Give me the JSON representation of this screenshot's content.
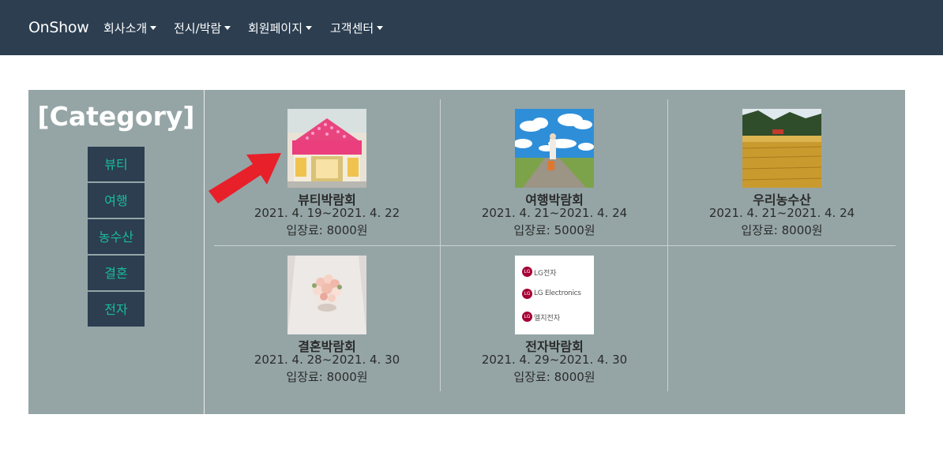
{
  "nav": {
    "brand": "OnShow",
    "items": [
      {
        "label": "회사소개"
      },
      {
        "label": "전시/박람"
      },
      {
        "label": "회원페이지"
      },
      {
        "label": "고객센터"
      }
    ]
  },
  "sidebar": {
    "title": "[Category]",
    "categories": [
      {
        "label": "뷰티"
      },
      {
        "label": "여행"
      },
      {
        "label": "농수산"
      },
      {
        "label": "결혼"
      },
      {
        "label": "전자"
      }
    ]
  },
  "exhibitions": [
    {
      "title": "뷰티박람회",
      "dates": "2021. 4. 19~2021. 4. 22",
      "fee": "입장료: 8000원",
      "image": "pink-storefront"
    },
    {
      "title": "여행박람회",
      "dates": "2021. 4. 21~2021. 4. 24",
      "fee": "입장료: 5000원",
      "image": "traveler-on-road"
    },
    {
      "title": "우리농수산",
      "dates": "2021. 4. 21~2021. 4. 24",
      "fee": "입장료: 8000원",
      "image": "golden-rice-field"
    },
    {
      "title": "결혼박람회",
      "dates": "2021. 4. 28~2021. 4. 30",
      "fee": "입장료: 8000원",
      "image": "bride-bouquet"
    },
    {
      "title": "전자박람회",
      "dates": "2021. 4. 29~2021. 4. 30",
      "fee": "입장료: 8000원",
      "image": "lg-logos"
    }
  ],
  "lg_logo": {
    "line1": "LG전자",
    "line2": "LG Electronics",
    "line3": "엘지전자",
    "mark": "LG"
  },
  "colors": {
    "navbar": "#2c3e50",
    "panel": "#95a5a6",
    "category_text": "#1abc9c",
    "arrow": "#e8202a",
    "lg_red": "#a50034"
  }
}
